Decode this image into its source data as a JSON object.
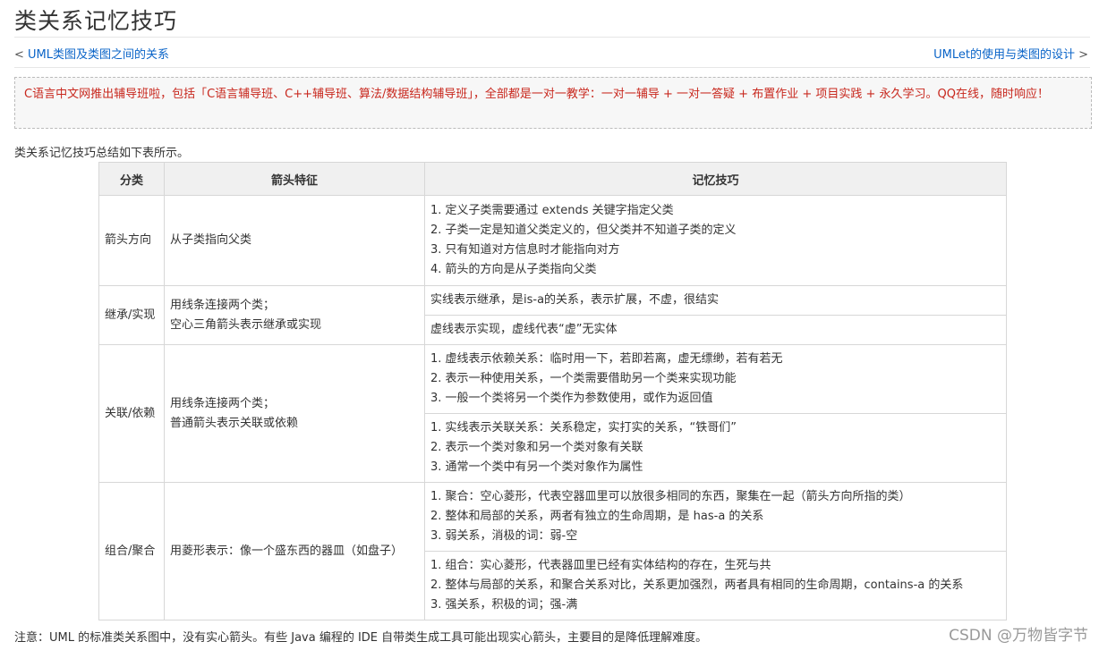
{
  "header": {
    "title": "类关系记忆技巧",
    "prev_arrow": "<",
    "prev_label": "UML类图及类图之间的关系",
    "next_label": "UMLet的使用与类图的设计",
    "next_arrow": ">"
  },
  "promo": {
    "text": "C语言中文网推出辅导班啦，包括「C语言辅导班、C++辅导班、算法/数据结构辅导班」，全部都是一对一教学：一对一辅导 + 一对一答疑 + 布置作业 + 项目实践 + 永久学习。QQ在线，随时响应！"
  },
  "intro": "类关系记忆技巧总结如下表所示。",
  "table": {
    "headers": [
      "分类",
      "箭头特征",
      "记忆技巧"
    ],
    "rows": [
      {
        "category": "箭头方向",
        "arrow": [
          "从子类指向父类"
        ],
        "tips": [
          [
            "1. 定义子类需要通过 extends 关键字指定父类",
            "2. 子类一定是知道父类定义的，但父类并不知道子类的定义",
            "3. 只有知道对方信息时才能指向对方",
            "4. 箭头的方向是从子类指向父类"
          ]
        ]
      },
      {
        "category": "继承/实现",
        "arrow": [
          "用线条连接两个类；",
          "空心三角箭头表示继承或实现"
        ],
        "tips": [
          [
            "实线表示继承，是is-a的关系，表示扩展，不虚，很结实"
          ],
          [
            "虚线表示实现，虚线代表“虚”无实体"
          ]
        ]
      },
      {
        "category": "关联/依赖",
        "arrow": [
          "用线条连接两个类；",
          "普通箭头表示关联或依赖"
        ],
        "tips": [
          [
            "1. 虚线表示依赖关系：临时用一下，若即若离，虚无缥缈，若有若无",
            "2. 表示一种使用关系，一个类需要借助另一个类来实现功能",
            "3. 一般一个类将另一个类作为参数使用，或作为返回值"
          ],
          [
            "1. 实线表示关联关系：关系稳定，实打实的关系，“铁哥们”",
            "2. 表示一个类对象和另一个类对象有关联",
            "3. 通常一个类中有另一个类对象作为属性"
          ]
        ]
      },
      {
        "category": "组合/聚合",
        "arrow": [
          "用菱形表示：像一个盛东西的器皿（如盘子）"
        ],
        "tips": [
          [
            "1. 聚合：空心菱形，代表空器皿里可以放很多相同的东西，聚集在一起（箭头方向所指的类）",
            "2. 整体和局部的关系，两者有独立的生命周期，是 has-a 的关系",
            "3. 弱关系，消极的词：弱-空"
          ],
          [
            "1. 组合：实心菱形，代表器皿里已经有实体结构的存在，生死与共",
            "2. 整体与局部的关系，和聚合关系对比，关系更加强烈，两者具有相同的生命周期，contains-a 的关系",
            "3. 强关系，积极的词；强-满"
          ]
        ]
      }
    ]
  },
  "note": "注意：UML 的标准类关系图中，没有实心箭头。有些 Java 编程的 IDE 自带类生成工具可能出现实心箭头，主要目的是降低理解难度。",
  "watermark": "CSDN @万物皆字节"
}
